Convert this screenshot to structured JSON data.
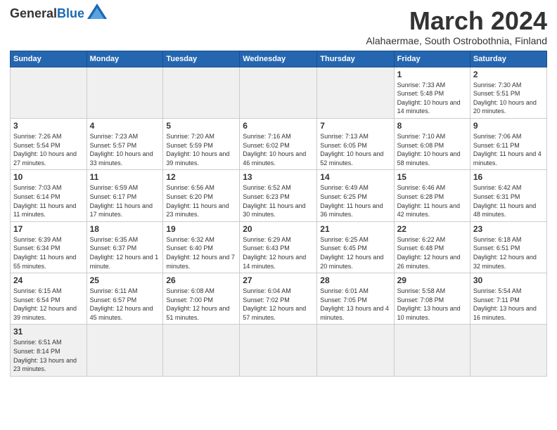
{
  "header": {
    "logo_general": "General",
    "logo_blue": "Blue",
    "month_title": "March 2024",
    "subtitle": "Alahaermae, South Ostrobothnia, Finland"
  },
  "weekdays": [
    "Sunday",
    "Monday",
    "Tuesday",
    "Wednesday",
    "Thursday",
    "Friday",
    "Saturday"
  ],
  "weeks": [
    [
      {
        "day": "",
        "info": ""
      },
      {
        "day": "",
        "info": ""
      },
      {
        "day": "",
        "info": ""
      },
      {
        "day": "",
        "info": ""
      },
      {
        "day": "",
        "info": ""
      },
      {
        "day": "1",
        "info": "Sunrise: 7:33 AM\nSunset: 5:48 PM\nDaylight: 10 hours and 14 minutes."
      },
      {
        "day": "2",
        "info": "Sunrise: 7:30 AM\nSunset: 5:51 PM\nDaylight: 10 hours and 20 minutes."
      }
    ],
    [
      {
        "day": "3",
        "info": "Sunrise: 7:26 AM\nSunset: 5:54 PM\nDaylight: 10 hours and 27 minutes."
      },
      {
        "day": "4",
        "info": "Sunrise: 7:23 AM\nSunset: 5:57 PM\nDaylight: 10 hours and 33 minutes."
      },
      {
        "day": "5",
        "info": "Sunrise: 7:20 AM\nSunset: 5:59 PM\nDaylight: 10 hours and 39 minutes."
      },
      {
        "day": "6",
        "info": "Sunrise: 7:16 AM\nSunset: 6:02 PM\nDaylight: 10 hours and 46 minutes."
      },
      {
        "day": "7",
        "info": "Sunrise: 7:13 AM\nSunset: 6:05 PM\nDaylight: 10 hours and 52 minutes."
      },
      {
        "day": "8",
        "info": "Sunrise: 7:10 AM\nSunset: 6:08 PM\nDaylight: 10 hours and 58 minutes."
      },
      {
        "day": "9",
        "info": "Sunrise: 7:06 AM\nSunset: 6:11 PM\nDaylight: 11 hours and 4 minutes."
      }
    ],
    [
      {
        "day": "10",
        "info": "Sunrise: 7:03 AM\nSunset: 6:14 PM\nDaylight: 11 hours and 11 minutes."
      },
      {
        "day": "11",
        "info": "Sunrise: 6:59 AM\nSunset: 6:17 PM\nDaylight: 11 hours and 17 minutes."
      },
      {
        "day": "12",
        "info": "Sunrise: 6:56 AM\nSunset: 6:20 PM\nDaylight: 11 hours and 23 minutes."
      },
      {
        "day": "13",
        "info": "Sunrise: 6:52 AM\nSunset: 6:23 PM\nDaylight: 11 hours and 30 minutes."
      },
      {
        "day": "14",
        "info": "Sunrise: 6:49 AM\nSunset: 6:25 PM\nDaylight: 11 hours and 36 minutes."
      },
      {
        "day": "15",
        "info": "Sunrise: 6:46 AM\nSunset: 6:28 PM\nDaylight: 11 hours and 42 minutes."
      },
      {
        "day": "16",
        "info": "Sunrise: 6:42 AM\nSunset: 6:31 PM\nDaylight: 11 hours and 48 minutes."
      }
    ],
    [
      {
        "day": "17",
        "info": "Sunrise: 6:39 AM\nSunset: 6:34 PM\nDaylight: 11 hours and 55 minutes."
      },
      {
        "day": "18",
        "info": "Sunrise: 6:35 AM\nSunset: 6:37 PM\nDaylight: 12 hours and 1 minute."
      },
      {
        "day": "19",
        "info": "Sunrise: 6:32 AM\nSunset: 6:40 PM\nDaylight: 12 hours and 7 minutes."
      },
      {
        "day": "20",
        "info": "Sunrise: 6:29 AM\nSunset: 6:43 PM\nDaylight: 12 hours and 14 minutes."
      },
      {
        "day": "21",
        "info": "Sunrise: 6:25 AM\nSunset: 6:45 PM\nDaylight: 12 hours and 20 minutes."
      },
      {
        "day": "22",
        "info": "Sunrise: 6:22 AM\nSunset: 6:48 PM\nDaylight: 12 hours and 26 minutes."
      },
      {
        "day": "23",
        "info": "Sunrise: 6:18 AM\nSunset: 6:51 PM\nDaylight: 12 hours and 32 minutes."
      }
    ],
    [
      {
        "day": "24",
        "info": "Sunrise: 6:15 AM\nSunset: 6:54 PM\nDaylight: 12 hours and 39 minutes."
      },
      {
        "day": "25",
        "info": "Sunrise: 6:11 AM\nSunset: 6:57 PM\nDaylight: 12 hours and 45 minutes."
      },
      {
        "day": "26",
        "info": "Sunrise: 6:08 AM\nSunset: 7:00 PM\nDaylight: 12 hours and 51 minutes."
      },
      {
        "day": "27",
        "info": "Sunrise: 6:04 AM\nSunset: 7:02 PM\nDaylight: 12 hours and 57 minutes."
      },
      {
        "day": "28",
        "info": "Sunrise: 6:01 AM\nSunset: 7:05 PM\nDaylight: 13 hours and 4 minutes."
      },
      {
        "day": "29",
        "info": "Sunrise: 5:58 AM\nSunset: 7:08 PM\nDaylight: 13 hours and 10 minutes."
      },
      {
        "day": "30",
        "info": "Sunrise: 5:54 AM\nSunset: 7:11 PM\nDaylight: 13 hours and 16 minutes."
      }
    ],
    [
      {
        "day": "31",
        "info": "Sunrise: 6:51 AM\nSunset: 8:14 PM\nDaylight: 13 hours and 23 minutes."
      },
      {
        "day": "",
        "info": ""
      },
      {
        "day": "",
        "info": ""
      },
      {
        "day": "",
        "info": ""
      },
      {
        "day": "",
        "info": ""
      },
      {
        "day": "",
        "info": ""
      },
      {
        "day": "",
        "info": ""
      }
    ]
  ]
}
